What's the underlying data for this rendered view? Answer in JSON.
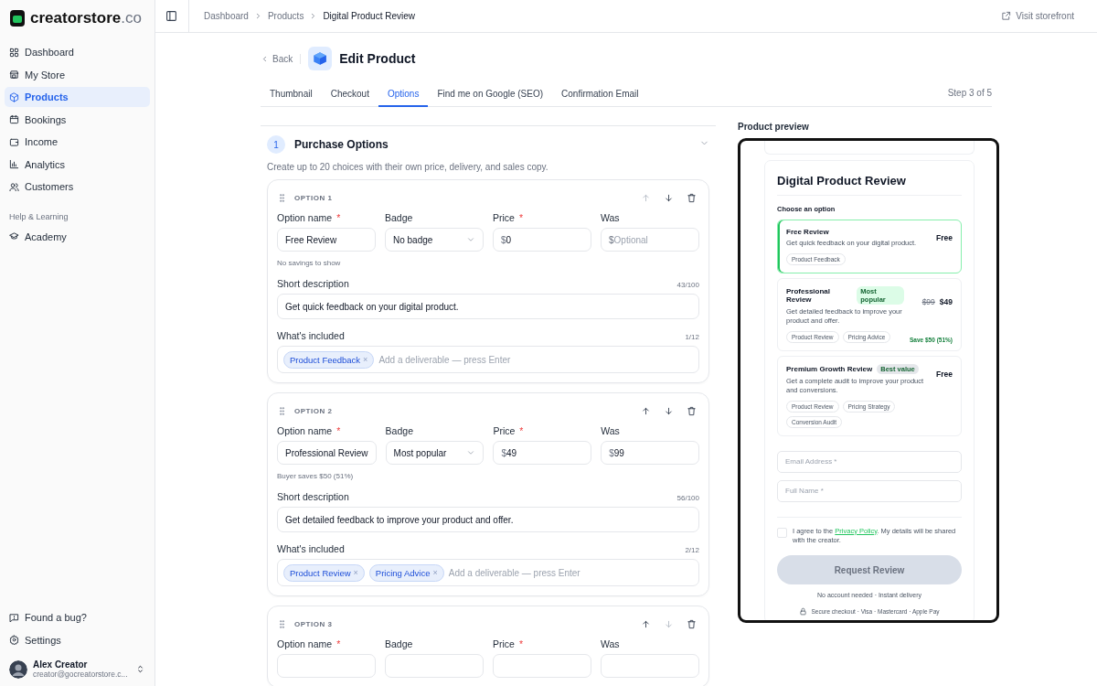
{
  "brand": {
    "name": "creatorstore",
    "suffix": ".co"
  },
  "sidebar": {
    "items": [
      {
        "label": "Dashboard",
        "selected": false
      },
      {
        "label": "My Store",
        "selected": false
      },
      {
        "label": "Products",
        "selected": true
      },
      {
        "label": "Bookings",
        "selected": false
      },
      {
        "label": "Income",
        "selected": false
      },
      {
        "label": "Analytics",
        "selected": false
      },
      {
        "label": "Customers",
        "selected": false
      }
    ],
    "section_title": "Help & Learning",
    "help_items": [
      {
        "label": "Academy"
      }
    ],
    "footer_items": [
      {
        "label": "Found a bug?"
      },
      {
        "label": "Settings"
      }
    ],
    "user": {
      "name": "Alex Creator",
      "email": "creator@gocreatorstore.c..."
    }
  },
  "breadcrumbs": [
    {
      "label": "Dashboard",
      "current": false
    },
    {
      "label": "Products",
      "current": false
    },
    {
      "label": "Digital Product Review",
      "current": true
    }
  ],
  "visit_link": "Visit storefront",
  "back_label": "Back",
  "page_title": "Edit Product",
  "tabs": [
    {
      "label": "Thumbnail",
      "selected": false
    },
    {
      "label": "Checkout",
      "selected": false
    },
    {
      "label": "Options",
      "selected": true
    },
    {
      "label": "Find me on Google (SEO)",
      "selected": false
    },
    {
      "label": "Confirmation Email",
      "selected": false
    }
  ],
  "step": "Step 3 of 5",
  "section": {
    "number": "1",
    "title": "Purchase Options",
    "expanded": true,
    "description": "Create up to 20 choices with their own price, delivery, and sales copy."
  },
  "options": [
    {
      "title": "OPTION 1",
      "up_disabled": true,
      "down_disabled": false,
      "name_label": {
        "text": "Option name",
        "mark": "*"
      },
      "badge_label": {
        "text": "Badge"
      },
      "price_label": {
        "text": "Price",
        "mark": "*"
      },
      "was_label": {
        "text": "Was"
      },
      "name": {
        "value": "Free Review"
      },
      "badge": {
        "value": "No badge"
      },
      "price": {
        "prefix": "$",
        "value": "0"
      },
      "was": {
        "prefix": "$",
        "placeholder": "Optional"
      },
      "note": "No savings to show",
      "desc_label": "Short description",
      "desc_count": "43/100",
      "desc": "Get quick feedback on your digital product.",
      "incl_label": "What's included",
      "incl_count": "1/12",
      "chips": [
        {
          "label": "Product Feedback",
          "remove": "×"
        }
      ],
      "incl_placeholder": "Add a deliverable — press Enter"
    },
    {
      "title": "OPTION 2",
      "up_disabled": false,
      "down_disabled": false,
      "name_label": {
        "text": "Option name",
        "mark": "*"
      },
      "badge_label": {
        "text": "Badge"
      },
      "price_label": {
        "text": "Price",
        "mark": "*"
      },
      "was_label": {
        "text": "Was"
      },
      "name": {
        "value": "Professional Review"
      },
      "badge": {
        "value": "Most popular"
      },
      "price": {
        "prefix": "$",
        "value": "49"
      },
      "was": {
        "prefix": "$",
        "value": "99"
      },
      "note": "Buyer saves $50 (51%)",
      "desc_label": "Short description",
      "desc_count": "56/100",
      "desc": "Get detailed feedback to improve your product and offer.",
      "incl_label": "What's included",
      "incl_count": "2/12",
      "chips": [
        {
          "label": "Product Review",
          "remove": "×"
        },
        {
          "label": "Pricing Advice",
          "remove": "×"
        }
      ],
      "incl_placeholder": "Add a deliverable — press Enter"
    },
    {
      "title": "OPTION 3",
      "up_disabled": false,
      "down_disabled": true,
      "name_label": {
        "text": "Option name",
        "mark": "*"
      },
      "badge_label": {
        "text": "Badge"
      },
      "price_label": {
        "text": "Price",
        "mark": "*"
      },
      "was_label": {
        "text": "Was"
      }
    }
  ],
  "preview": {
    "label": "Product preview",
    "title": "Digital Product Review",
    "choose_label": "Choose an option",
    "options": [
      {
        "name": "Free Review",
        "selected": true,
        "description": "Get quick feedback on your digital product.",
        "price": "Free",
        "chips": [
          "Product Feedback"
        ]
      },
      {
        "name": "Professional Review",
        "selected": false,
        "badge": {
          "text": "Most popular",
          "color": "#dcfce7"
        },
        "description": "Get detailed feedback to improve your product and offer.",
        "was": "$99",
        "price": "$49",
        "save": "Save $50 (51%)",
        "chips": [
          "Product Review",
          "Pricing Advice"
        ]
      },
      {
        "name": "Premium Growth Review",
        "selected": false,
        "badge": {
          "text": "Best value",
          "color": "#e5e7eb"
        },
        "description": "Get a complete audit to improve your product and conversions.",
        "price": "Free",
        "chips": [
          "Product Review",
          "Pricing Strategy",
          "Conversion Audit"
        ]
      }
    ],
    "fields": [
      {
        "placeholder": "Email Address *"
      },
      {
        "placeholder": "Full Name *"
      }
    ],
    "consent": {
      "checked": false,
      "before": "I agree to the ",
      "link": "Privacy Policy",
      "after": ". My details will be shared with the creator."
    },
    "button": {
      "label": "Request Review",
      "disabled": true
    },
    "note": "No account needed · Instant delivery",
    "secure": "Secure checkout · Visa · Mastercard · Apple Pay"
  }
}
